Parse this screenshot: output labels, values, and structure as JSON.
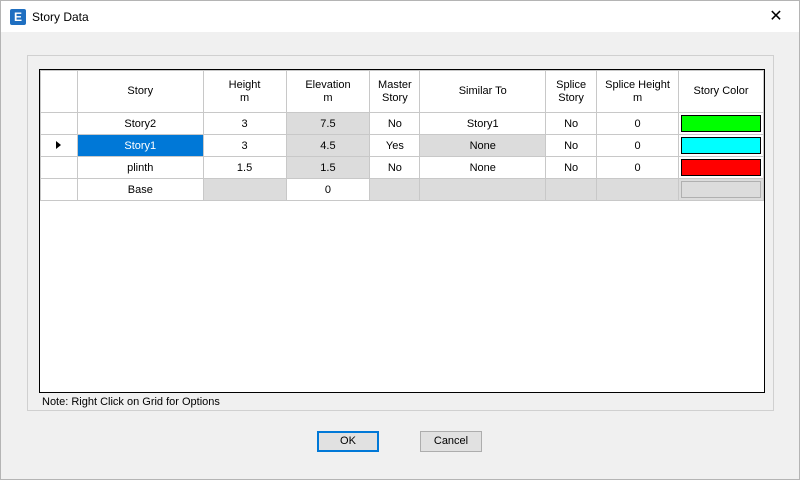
{
  "window": {
    "title": "Story Data",
    "app_icon_letter": "E",
    "close_glyph": "✕"
  },
  "grid": {
    "headers": [
      {
        "line1": "Story",
        "line2": ""
      },
      {
        "line1": "Height",
        "line2": "m"
      },
      {
        "line1": "Elevation",
        "line2": "m"
      },
      {
        "line1": "Master",
        "line2": "Story"
      },
      {
        "line1": "Similar To",
        "line2": ""
      },
      {
        "line1": "Splice",
        "line2": "Story"
      },
      {
        "line1": "Splice Height",
        "line2": "m"
      },
      {
        "line1": "Story Color",
        "line2": ""
      }
    ],
    "rows": [
      {
        "story": "Story2",
        "height": "3",
        "elevation": "7.5",
        "master": "No",
        "similar": "Story1",
        "splice": "No",
        "splice_height": "0",
        "color": "#00ff00"
      },
      {
        "story": "Story1",
        "height": "3",
        "elevation": "4.5",
        "master": "Yes",
        "similar": "None",
        "splice": "No",
        "splice_height": "0",
        "color": "#00ffff"
      },
      {
        "story": "plinth",
        "height": "1.5",
        "elevation": "1.5",
        "master": "No",
        "similar": "None",
        "splice": "No",
        "splice_height": "0",
        "color": "#ff0000"
      },
      {
        "story": "Base",
        "height": "",
        "elevation": "0",
        "master": "",
        "similar": "",
        "splice": "",
        "splice_height": "",
        "color": ""
      }
    ]
  },
  "note": "Note:  Right Click on Grid for Options",
  "buttons": {
    "ok": "OK",
    "cancel": "Cancel"
  }
}
